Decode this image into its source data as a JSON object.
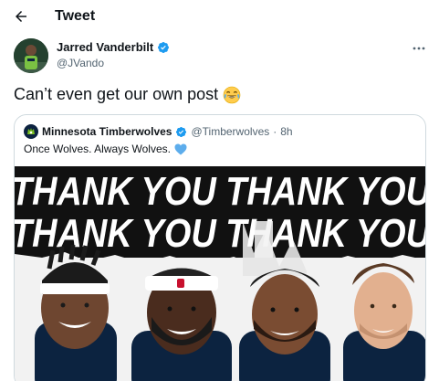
{
  "header": {
    "title": "Tweet",
    "back_icon": "arrow-left-icon"
  },
  "author": {
    "name": "Jarred Vanderbilt",
    "handle": "@JVando",
    "verified": true,
    "more_icon": "more-horizontal-icon"
  },
  "tweet": {
    "text": "Can’t even get our own post",
    "emoji": "face-with-tears-of-joy-emoji"
  },
  "quoted_tweet": {
    "name": "Minnesota Timberwolves",
    "verified": true,
    "handle": "@Timberwolves",
    "separator": "·",
    "time": "8h",
    "text": "Once Wolves. Always Wolves.",
    "heart_icon": "blue-heart-emoji",
    "media": {
      "banner_line_1": "THANK YOU THANK YOU",
      "banner_line_2": "THANK YOU THANK YOU",
      "players_count_shown": 4
    }
  },
  "colors": {
    "text_primary": "#0f1419",
    "text_secondary": "#536471",
    "verified_blue": "#1d9bf0",
    "border": "#cfd9de",
    "banner_black": "#111111"
  }
}
